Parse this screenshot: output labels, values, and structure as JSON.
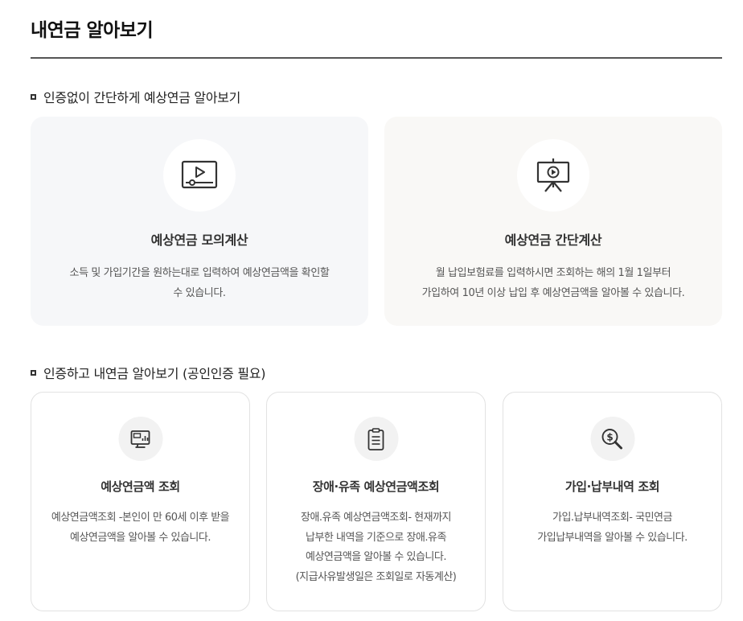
{
  "page": {
    "title": "내연금 알아보기"
  },
  "section1": {
    "title": "인증없이 간단하게 예상연금 알아보기",
    "cards": [
      {
        "icon": "video-player-icon",
        "title": "예상연금 모의계산",
        "desc_lines": [
          "소득 및 가입기간을 원하는대로 입력하여 예상연금액을 확인할",
          "수 있습니다."
        ]
      },
      {
        "icon": "presentation-board-icon",
        "title": "예상연금 간단계산",
        "desc_lines": [
          "월 납입보험료를 입력하시면 조회하는 해의 1월 1일부터",
          "가입하여 10년 이상 납입 후 예상연금액을 알아볼 수 있습니다."
        ]
      }
    ]
  },
  "section2": {
    "title": "인증하고 내연금 알아보기 (공인인증 필요)",
    "cards": [
      {
        "icon": "monitor-chart-icon",
        "title": "예상연금액 조회",
        "desc_lines": [
          "예상연금액조회 -본인이 만 60세 이후 받을",
          "예상연금액을 알아볼 수 있습니다."
        ]
      },
      {
        "icon": "clipboard-icon",
        "title": "장애·유족 예상연금액조회",
        "desc_lines": [
          "장애.유족 예상연금액조회- 현재까지",
          "납부한 내역을 기준으로 장애.유족",
          "예상연금액을 알아볼 수 있습니다.",
          "(지급사유발생일은 조회일로 자동계산)"
        ]
      },
      {
        "icon": "magnifier-dollar-icon",
        "title": "가입·납부내역 조회",
        "desc_lines": [
          "가입.납부내역조회- 국민연금",
          "가입납부내역을 알아볼 수 있습니다."
        ]
      }
    ]
  }
}
